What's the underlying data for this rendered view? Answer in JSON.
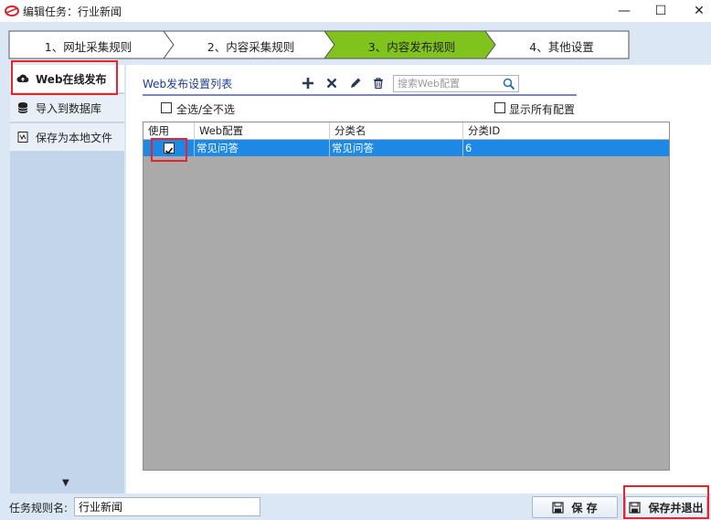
{
  "window": {
    "title": "编辑任务：行业新闻",
    "minimize": "—",
    "maximize": "☐",
    "close": "✕"
  },
  "steps": [
    {
      "label": "1、网址采集规则",
      "active": false
    },
    {
      "label": "2、内容采集规则",
      "active": false
    },
    {
      "label": "3、内容发布规则",
      "active": true
    },
    {
      "label": "4、其他设置",
      "active": false
    }
  ],
  "sidebar": {
    "items": [
      {
        "label": "Web在线发布",
        "icon": "cloud-upload-icon",
        "active": true
      },
      {
        "label": "导入到数据库",
        "icon": "database-icon",
        "active": false
      },
      {
        "label": "保存为本地文件",
        "icon": "file-icon",
        "active": false
      }
    ],
    "scroll_arrow": "▼"
  },
  "panel": {
    "title": "Web发布设置列表",
    "search_placeholder": "搜索Web配置",
    "select_all_label": "全选/全不选",
    "show_all_label": "显示所有配置"
  },
  "grid": {
    "columns": [
      "使用",
      "Web配置",
      "分类名",
      "分类ID"
    ],
    "rows": [
      {
        "use": true,
        "web_config": "常见问答",
        "category_name": "常见问答",
        "category_id": "6"
      }
    ]
  },
  "footer": {
    "rule_name_label": "任务规则名:",
    "rule_name_value": "行业新闻",
    "save_label": "保 存",
    "save_exit_label": "保存并退出"
  },
  "colors": {
    "active_step": "#7fc31c",
    "selection": "#1e88e5",
    "highlight": "#e8232b"
  }
}
